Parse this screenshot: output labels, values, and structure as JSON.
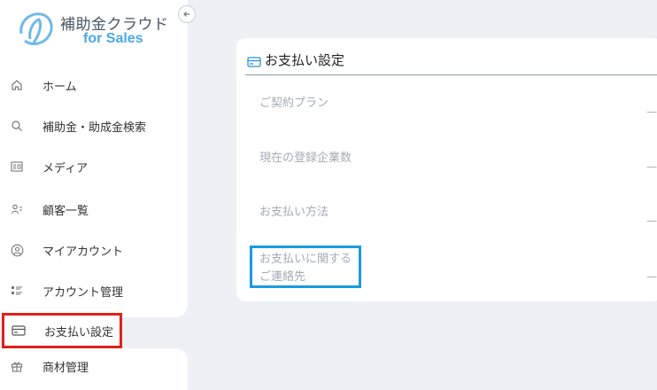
{
  "brand": {
    "title": "補助金クラウド",
    "subtitle": "for Sales"
  },
  "sidebar": {
    "items": [
      {
        "label": "ホーム",
        "icon": "home-icon"
      },
      {
        "label": "補助金・助成金検索",
        "icon": "search-icon"
      },
      {
        "label": "メディア",
        "icon": "media-icon"
      },
      {
        "label": "顧客一覧",
        "icon": "customers-icon"
      },
      {
        "label": "マイアカウント",
        "icon": "account-icon"
      },
      {
        "label": "アカウント管理",
        "icon": "account-management-icon"
      },
      {
        "label": "お支払い設定",
        "icon": "card-icon",
        "active": true
      },
      {
        "label": "商材管理",
        "icon": "gift-icon"
      }
    ]
  },
  "main": {
    "title": "お支払い設定",
    "rows": [
      {
        "label": "ご契約プラン",
        "value": "—"
      },
      {
        "label": "現在の登録企業数",
        "value": "—"
      },
      {
        "label": "お支払い方法",
        "value": "—"
      },
      {
        "label_line1": "お支払いに関する",
        "label_line2": "ご連絡先",
        "value": "—"
      }
    ]
  },
  "colors": {
    "active_outline": "#e0201a",
    "annotation_outline": "#1a9be0",
    "brand_blue": "#4aa7e8"
  }
}
